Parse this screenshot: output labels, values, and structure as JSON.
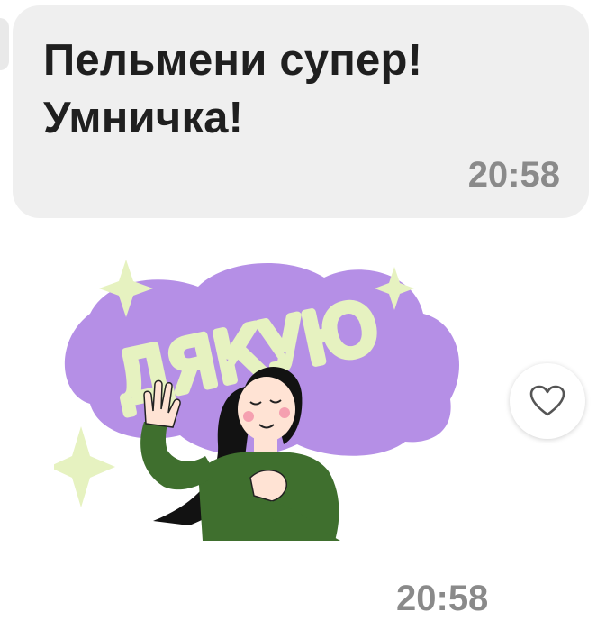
{
  "message": {
    "lines": [
      "Пельмени супер!",
      "Умничка!"
    ],
    "time": "20:58"
  },
  "sticker": {
    "label": "ДЯКУЮ",
    "time": "20:58"
  },
  "like_button": {
    "icon": "heart-outline-icon"
  },
  "colors": {
    "bubble_bg": "#efefef",
    "time_text": "#8a8a8a",
    "sticker_cloud": "#b58fe6",
    "sticker_text": "#e6f2c0",
    "sweater": "#3f6f2e"
  }
}
